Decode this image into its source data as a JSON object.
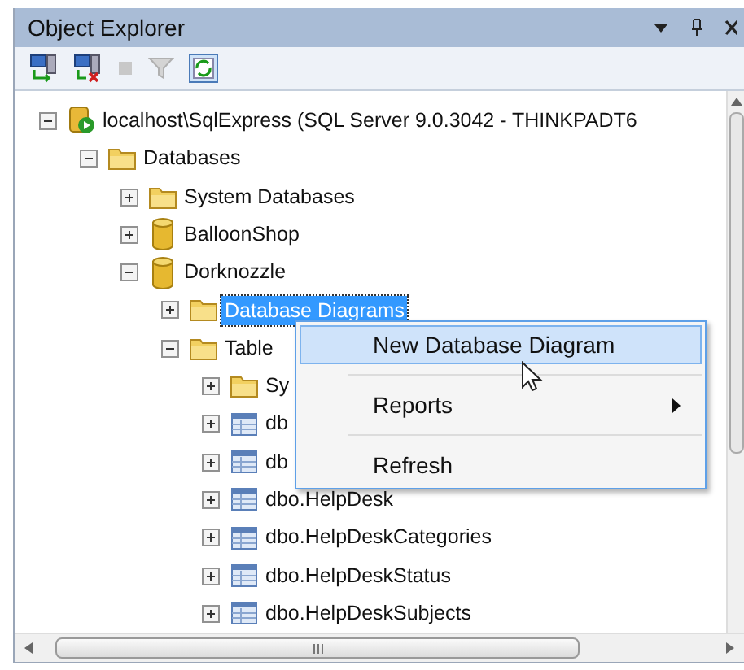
{
  "window": {
    "title": "Object Explorer"
  },
  "tree": [
    {
      "label": "localhost\\SqlExpress (SQL Server 9.0.3042 - THINKPADT6",
      "kind": "server",
      "expanded": true,
      "selected": false,
      "children": [
        {
          "label": "Databases",
          "kind": "folder",
          "expanded": true,
          "selected": false,
          "children": [
            {
              "label": "System Databases",
              "kind": "folder",
              "expanded": false,
              "selected": false
            },
            {
              "label": "BalloonShop",
              "kind": "database",
              "expanded": false,
              "selected": false
            },
            {
              "label": "Dorknozzle",
              "kind": "database",
              "expanded": true,
              "selected": false,
              "children": [
                {
                  "label": "Database Diagrams",
                  "kind": "folder",
                  "expanded": false,
                  "selected": true
                },
                {
                  "label": "Table",
                  "kind": "folder",
                  "expanded": true,
                  "selected": false,
                  "children": [
                    {
                      "label": "Sy",
                      "kind": "folder",
                      "expanded": false,
                      "selected": false
                    },
                    {
                      "label": "db",
                      "kind": "table",
                      "expanded": false,
                      "selected": false
                    },
                    {
                      "label": "db",
                      "kind": "table",
                      "expanded": false,
                      "selected": false
                    },
                    {
                      "label": "dbo.HelpDesk",
                      "kind": "table",
                      "expanded": false,
                      "selected": false
                    },
                    {
                      "label": "dbo.HelpDeskCategories",
                      "kind": "table",
                      "expanded": false,
                      "selected": false
                    },
                    {
                      "label": "dbo.HelpDeskStatus",
                      "kind": "table",
                      "expanded": false,
                      "selected": false
                    },
                    {
                      "label": "dbo.HelpDeskSubjects",
                      "kind": "table",
                      "expanded": false,
                      "selected": false
                    }
                  ]
                }
              ]
            }
          ]
        }
      ]
    }
  ],
  "context_menu": [
    {
      "label": "New Database Diagram",
      "selected": true,
      "submenu": false
    },
    {
      "label": "Reports",
      "selected": false,
      "submenu": true
    },
    {
      "label": "Refresh",
      "selected": false,
      "submenu": false
    }
  ]
}
